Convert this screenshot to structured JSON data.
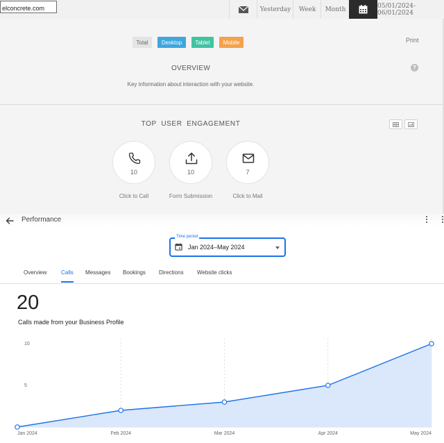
{
  "topbar": {
    "site_value": "elconcrete.com",
    "mail_icon": "envelope-icon",
    "yesterday": "Yesterday",
    "week": "Week",
    "month": "Month",
    "calendar_icon": "calendar-icon",
    "date_range": "05/01/2024-06/01/2024"
  },
  "filters": {
    "total": "Total",
    "desktop": "Desktop",
    "tablet": "Tablet",
    "mobile": "Mobile",
    "colors": {
      "desktop": "#3fa6de",
      "tablet": "#3fc4a0",
      "mobile": "#f4a24c",
      "total_bg": "#e4e4e4"
    }
  },
  "panel": {
    "print": "Print",
    "help": "?",
    "overview_title": "OVERVIEW",
    "overview_subtitle": "Key information about interaction with your website.",
    "engagement_title": "TOP  USER  ENGAGEMENT",
    "items": [
      {
        "icon": "phone-icon",
        "count": "10",
        "label": "Click to Call"
      },
      {
        "icon": "upload-icon",
        "count": "10",
        "label": "Form Submission"
      },
      {
        "icon": "mail-icon",
        "count": "7",
        "label": "Click to Mail"
      }
    ]
  },
  "performance": {
    "title": "Performance",
    "time_label": "Time period",
    "time_value": "Jan 2024–May 2024",
    "tabs": [
      "Overview",
      "Calls",
      "Messages",
      "Bookings",
      "Directions",
      "Website clicks"
    ],
    "active_tab": "Calls",
    "total": "20",
    "caption": "Calls made from your Business Profile",
    "accent": "#1a73e8"
  },
  "chart_data": {
    "type": "area",
    "categories": [
      "Jan 2024",
      "Feb 2024",
      "Mar 2024",
      "Apr 2024",
      "May 2024"
    ],
    "values": [
      0,
      2,
      3,
      5,
      10
    ],
    "yticks": [
      5,
      10
    ],
    "ylim": [
      0,
      10
    ],
    "xlabel": "",
    "ylabel": "",
    "title": "",
    "line_color": "#1a73e8",
    "fill_color": "#dbe7fb",
    "grid": "vertical-dashed"
  }
}
